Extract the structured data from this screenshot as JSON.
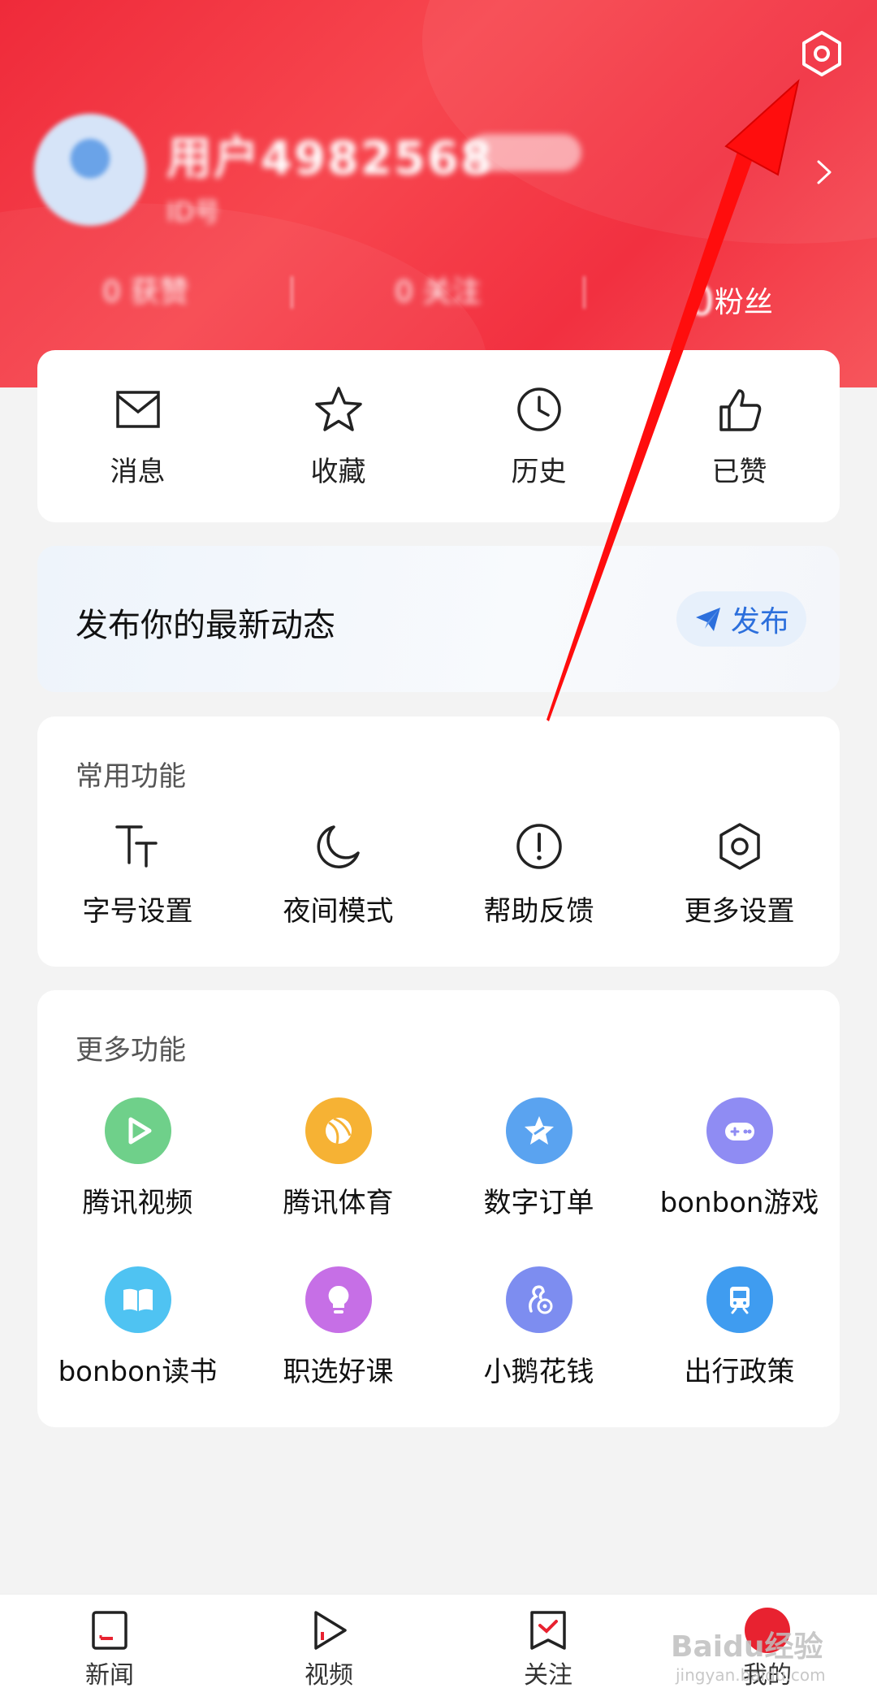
{
  "header": {
    "username": "用户4982568",
    "subtitle": "ID号",
    "stats": [
      {
        "label": "0 获赞"
      },
      {
        "label": "0 关注"
      },
      {
        "value": "0",
        "label": "粉丝"
      }
    ],
    "accent": "#f2303e"
  },
  "quick_actions": [
    {
      "label": "消息",
      "icon": "mail-icon"
    },
    {
      "label": "收藏",
      "icon": "star-icon"
    },
    {
      "label": "历史",
      "icon": "clock-icon"
    },
    {
      "label": "已赞",
      "icon": "thumbs-up-icon"
    }
  ],
  "post": {
    "prompt": "发布你的最新动态",
    "button_label": "发布"
  },
  "common_functions": {
    "title": "常用功能",
    "items": [
      {
        "label": "字号设置",
        "icon": "font-size-icon"
      },
      {
        "label": "夜间模式",
        "icon": "moon-icon"
      },
      {
        "label": "帮助反馈",
        "icon": "alert-circle-icon"
      },
      {
        "label": "更多设置",
        "icon": "hexagon-settings-icon"
      }
    ]
  },
  "more_functions": {
    "title": "更多功能",
    "items": [
      {
        "label": "腾讯视频",
        "icon": "play-icon",
        "color": "#6fd08a"
      },
      {
        "label": "腾讯体育",
        "icon": "ball-icon",
        "color": "#f6b234"
      },
      {
        "label": "数字订单",
        "icon": "star-badge-icon",
        "color": "#5aa3f0"
      },
      {
        "label": "bonbon游戏",
        "icon": "gamepad-icon",
        "color": "#8f8cf3"
      },
      {
        "label": "bonbon读书",
        "icon": "book-icon",
        "color": "#4fc3f2"
      },
      {
        "label": "职选好课",
        "icon": "bulb-icon",
        "color": "#c66fe6"
      },
      {
        "label": "小鹅花钱",
        "icon": "goose-coin-icon",
        "color": "#7d8df0"
      },
      {
        "label": "出行政策",
        "icon": "train-icon",
        "color": "#3f9cf0"
      }
    ]
  },
  "tabbar": [
    {
      "label": "新闻",
      "icon": "news-icon"
    },
    {
      "label": "视频",
      "icon": "video-icon"
    },
    {
      "label": "关注",
      "icon": "follow-icon"
    },
    {
      "label": "我的",
      "icon": "me-icon"
    }
  ],
  "watermark": {
    "brand": "Baidu经验",
    "url": "jingyan.baidu.com"
  }
}
